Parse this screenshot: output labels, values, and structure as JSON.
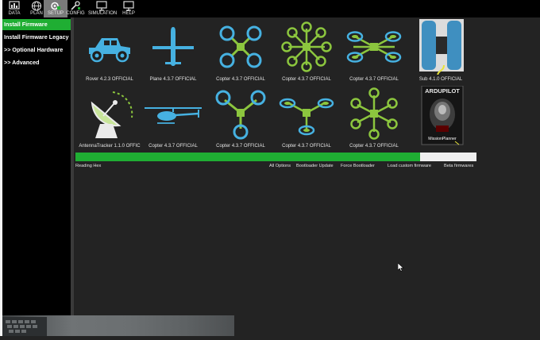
{
  "toolbar": [
    {
      "label": "DATA",
      "icon": "data-icon"
    },
    {
      "label": "PLAN",
      "icon": "plan-globe-icon"
    },
    {
      "label": "SETUP",
      "icon": "setup-icon",
      "active": true
    },
    {
      "label": "CONFIG",
      "icon": "config-icon"
    },
    {
      "label": "SIMULATION",
      "icon": "simulation-icon"
    },
    {
      "label": "HELP",
      "icon": "help-icon"
    }
  ],
  "sidebar": {
    "items": [
      {
        "label": "Install Firmware",
        "active": true
      },
      {
        "label": "Install Firmware Legacy"
      },
      {
        "label": ">> Optional Hardware"
      },
      {
        "label": ">> Advanced"
      }
    ]
  },
  "firmware": {
    "row1": [
      {
        "label": "Rover 4.2.3 OFFICIAL",
        "icon": "rover-icon"
      },
      {
        "label": "Plane 4.3.7 OFFICIAL",
        "icon": "plane-icon"
      },
      {
        "label": "Copter 4.3.7 OFFICIAL",
        "icon": "quad-copter-icon"
      },
      {
        "label": "Copter 4.3.7 OFFICIAL",
        "icon": "octo-copter-icon"
      },
      {
        "label": "Copter 4.3.7 OFFICIAL",
        "icon": "hexa-copter-icon"
      },
      {
        "label": "Sub 4.1.0 OFFICIAL",
        "icon": "sub-icon"
      }
    ],
    "row2": [
      {
        "label": "AntennaTracker   1.1.0 OFFIC",
        "icon": "antenna-tracker-icon"
      },
      {
        "label": "Copter 4.3.7 OFFICIAL",
        "icon": "helicopter-icon"
      },
      {
        "label": "Copter 4.3.7 OFFICIAL",
        "icon": "tri-copter-icon"
      },
      {
        "label": "Copter 4.3.7 OFFICIAL",
        "icon": "y6-copter-icon"
      },
      {
        "label": "Copter 4.3.7 OFFICIAL",
        "icon": "octa-copter-icon"
      },
      {
        "label": "",
        "icon": "ardupilot-missionplanner-logo"
      }
    ]
  },
  "logo": {
    "brand": "ARDUPILOT",
    "caption": "MissionPlanner"
  },
  "progress": {
    "fraction": 0.86
  },
  "status": {
    "text": "Reading Hex"
  },
  "links": {
    "all_options": "All Options",
    "bootloader_update": "Bootloader Update",
    "force_bootloader": "Force Bootloader",
    "load_custom": "Load custom firmware",
    "beta": "Beta firmwares"
  },
  "colors": {
    "accent": "#1fae33",
    "icon_blue": "#46b1e1",
    "icon_green": "#8cc63e"
  }
}
